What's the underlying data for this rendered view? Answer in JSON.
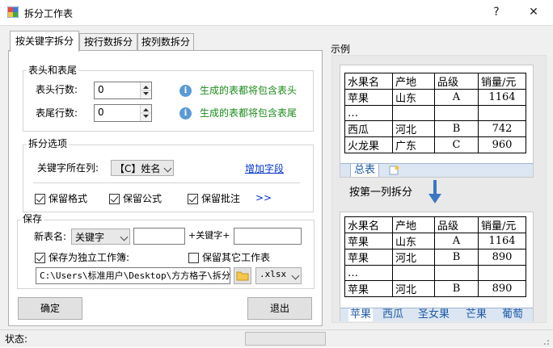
{
  "window": {
    "title": "拆分工作表",
    "help": "?",
    "close": "✕"
  },
  "tabs": [
    "按关键字拆分",
    "按行数拆分",
    "按列数拆分"
  ],
  "header_group": {
    "title": "表头和表尾",
    "head_label": "表头行数:",
    "head_value": "0",
    "tail_label": "表尾行数:",
    "tail_value": "0",
    "head_info": "生成的表都将包含表头",
    "tail_info": "生成的表都将包含表尾"
  },
  "split_group": {
    "title": "拆分选项",
    "key_col_label": "关键字所在列:",
    "key_col_value": "【C】姓名",
    "add_field_link": "增加字段",
    "keep_format": "保留格式",
    "keep_formula": "保留公式",
    "keep_comment": "保留批注",
    "more": ">>"
  },
  "save_group": {
    "title": "保存",
    "name_label": "新表名:",
    "name_prefix_value": "关键字",
    "plus_key": "+关键字+",
    "save_workbook_label": "保存为独立工作簿:",
    "keep_other_label": "保留其它工作表",
    "path_value": "C:\\Users\\标准用户\\Desktop\\方方格子\\拆分",
    "ext_value": ".xlsx"
  },
  "buttons": {
    "ok": "确定",
    "exit": "退出"
  },
  "status_label": "状态:",
  "example": {
    "label": "示例",
    "arrow_text": "按第一列拆分",
    "top_table": {
      "header": [
        "水果名",
        "产地",
        "品级",
        "销量/元"
      ],
      "rows": [
        [
          "苹果",
          "山东",
          "A",
          "1164"
        ],
        [
          "…",
          "",
          "",
          ""
        ],
        [
          "西瓜",
          "河北",
          "B",
          "742"
        ],
        [
          "火龙果",
          "广东",
          "C",
          "960"
        ]
      ],
      "tab": "总表"
    },
    "bottom_table": {
      "header": [
        "水果名",
        "产地",
        "品级",
        "销量/元"
      ],
      "rows": [
        [
          "苹果",
          "山东",
          "A",
          "1164"
        ],
        [
          "苹果",
          "河北",
          "B",
          "890"
        ],
        [
          "…",
          "",
          "",
          ""
        ],
        [
          "苹果",
          "河北",
          "B",
          "890"
        ]
      ],
      "tabs": [
        "苹果",
        "西瓜",
        "圣女果",
        "芒果",
        "葡萄"
      ]
    }
  },
  "colors": {
    "accent": "#1a8a1a",
    "link": "#0033cc",
    "arrow": "#3a78c3",
    "note": "#c00000"
  }
}
